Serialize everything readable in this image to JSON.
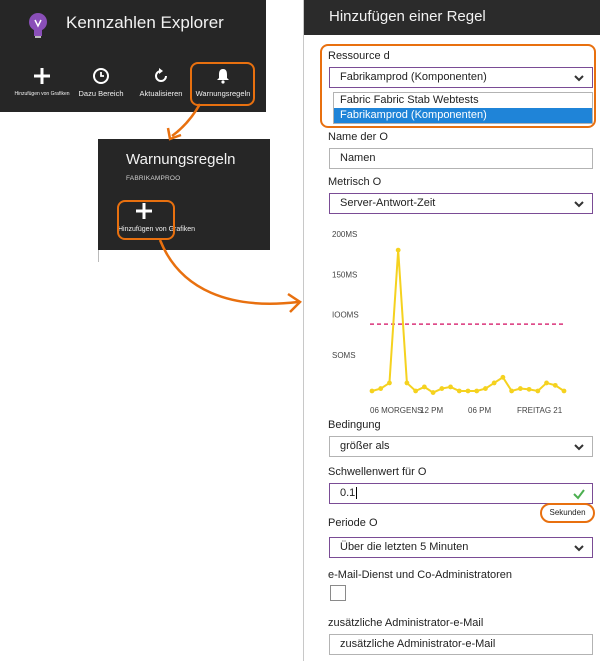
{
  "explorer": {
    "title": "Kennzahlen Explorer",
    "toolbar": [
      {
        "label": "Hinzufügen von Grafiken",
        "icon": "plus-icon"
      },
      {
        "label": "Dazu Bereich",
        "icon": "clock-icon"
      },
      {
        "label": "Aktualisieren",
        "icon": "refresh-icon"
      },
      {
        "label": "Warnungsregeln",
        "icon": "bell-icon"
      }
    ]
  },
  "warn_panel": {
    "title": "Warnungsregeln",
    "subtitle": "FABRIKAMPROO",
    "add_label": "Hinzufügen von Grafiken"
  },
  "blade": {
    "title": "Hinzufügen einer Regel",
    "resource": {
      "label": "Ressource d",
      "value": "Fabrikamprod (Komponenten)",
      "options": [
        "Fabric Fabric Stab Webtests",
        "Fabrikamprod (Komponenten)"
      ]
    },
    "name": {
      "label": "Name der O",
      "placeholder": "Namen"
    },
    "metric": {
      "label": "Metrisch O",
      "value": "Server-Antwort-Zeit"
    },
    "condition": {
      "label": "Bedingung",
      "value": "größer als"
    },
    "threshold": {
      "label": "Schwellenwert für O",
      "value": "0.1",
      "unit": "Sekunden"
    },
    "period": {
      "label": "Periode O",
      "value": "Über die letzten 5 Minuten"
    },
    "email": {
      "label": "e-Mail-Dienst und Co-Administratoren",
      "checked": false
    },
    "extra_email": {
      "label": "zusätzliche Administrator-e-Mail",
      "placeholder": "zusätzliche Administrator-e-Mail"
    }
  },
  "colors": {
    "accent": "#e8700f",
    "line": "#f5d21f",
    "threshold": "#d9337a",
    "selection": "#1f84d8"
  },
  "chart_data": {
    "type": "line",
    "y_ticks": [
      "200MS",
      "150MS",
      "IOOMS",
      "SOMS"
    ],
    "x_ticks": [
      "06 MORGENS",
      "12 PM",
      "06 PM",
      "FREITAG 21"
    ],
    "ylim": [
      0,
      200
    ],
    "threshold": 100,
    "series": [
      {
        "values": [
          5,
          8,
          15,
          180,
          15,
          5,
          10,
          3,
          8,
          10,
          5,
          5,
          5,
          8,
          15,
          22,
          5,
          8,
          7,
          5,
          15,
          12,
          5
        ]
      }
    ]
  }
}
